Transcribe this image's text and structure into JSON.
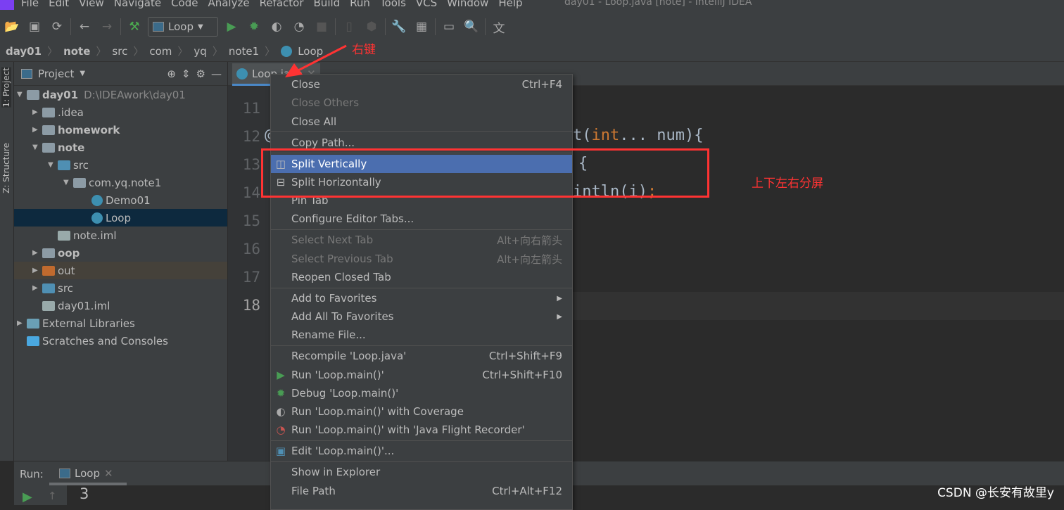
{
  "window_title": "day01 - Loop.java [note] - IntelliJ IDEA",
  "menu": [
    "File",
    "Edit",
    "View",
    "Navigate",
    "Code",
    "Analyze",
    "Refactor",
    "Build",
    "Run",
    "Tools",
    "VCS",
    "Window",
    "Help"
  ],
  "toolbar": {
    "run_config": "Loop"
  },
  "breadcrumb": [
    "day01",
    "note",
    "src",
    "com",
    "yq",
    "note1",
    "Loop"
  ],
  "sidebar": {
    "project_tab": "1: Project",
    "structure_tab": "Z: Structure"
  },
  "project": {
    "title": "Project",
    "tree": [
      {
        "label": "day01",
        "path": "D:\\IDEAwork\\day01",
        "bold": true,
        "level": 0,
        "expanded": true,
        "icon": "module-folder"
      },
      {
        "label": ".idea",
        "level": 1,
        "expanded": false,
        "icon": "folder"
      },
      {
        "label": "homework",
        "bold": true,
        "level": 1,
        "expanded": false,
        "icon": "module-folder"
      },
      {
        "label": "note",
        "bold": true,
        "level": 1,
        "expanded": true,
        "icon": "module-folder"
      },
      {
        "label": "src",
        "level": 2,
        "expanded": true,
        "icon": "source-folder"
      },
      {
        "label": "com.yq.note1",
        "level": 3,
        "expanded": true,
        "icon": "package"
      },
      {
        "label": "Demo01",
        "level": 4,
        "icon": "java-class"
      },
      {
        "label": "Loop",
        "level": 4,
        "icon": "java-class",
        "selected": true
      },
      {
        "label": "note.iml",
        "level": 2,
        "icon": "iml-file"
      },
      {
        "label": "oop",
        "bold": true,
        "level": 1,
        "expanded": false,
        "icon": "module-folder"
      },
      {
        "label": "out",
        "level": 1,
        "expanded": false,
        "icon": "excluded-folder",
        "highlight": true
      },
      {
        "label": "src",
        "level": 1,
        "expanded": false,
        "icon": "source-folder"
      },
      {
        "label": "day01.iml",
        "level": 1,
        "icon": "iml-file"
      },
      {
        "label": "External Libraries",
        "level": 0,
        "expanded": false,
        "icon": "libraries"
      },
      {
        "label": "Scratches and Consoles",
        "level": 0,
        "icon": "scratches"
      }
    ]
  },
  "editor": {
    "tab": "Loop.java",
    "line_numbers": [
      "11",
      "12",
      "13",
      "14",
      "15",
      "16",
      "17",
      "18"
    ],
    "code_fragments": {
      "l12_at": "@",
      "l12_tail_kw": "int",
      "l12_pre": "t(",
      "l12_tail": "... num){",
      "l13": "{",
      "l14": "intln(i)",
      "l14_semi": ";"
    }
  },
  "context_menu": [
    {
      "label": "Close",
      "shortcut": "Ctrl+F4"
    },
    {
      "label": "Close Others",
      "disabled": true
    },
    {
      "label": "Close All"
    },
    {
      "sep": true
    },
    {
      "label": "Copy Path..."
    },
    {
      "sep": true
    },
    {
      "label": "Split Vertically",
      "icon": "split-vertical-icon",
      "selected": true
    },
    {
      "label": "Split Horizontally",
      "icon": "split-horizontal-icon"
    },
    {
      "label": "Pin Tab"
    },
    {
      "label": "Configure Editor Tabs..."
    },
    {
      "sep": true
    },
    {
      "label": "Select Next Tab",
      "shortcut": "Alt+向右箭头",
      "disabled": true
    },
    {
      "label": "Select Previous Tab",
      "shortcut": "Alt+向左箭头",
      "disabled": true
    },
    {
      "label": "Reopen Closed Tab"
    },
    {
      "sep": true
    },
    {
      "label": "Add to Favorites",
      "submenu": true
    },
    {
      "label": "Add All To Favorites",
      "submenu": true
    },
    {
      "label": "Rename File..."
    },
    {
      "sep": true
    },
    {
      "label": "Recompile 'Loop.java'",
      "shortcut": "Ctrl+Shift+F9"
    },
    {
      "label": "Run 'Loop.main()'",
      "shortcut": "Ctrl+Shift+F10",
      "icon": "run-icon"
    },
    {
      "label": "Debug 'Loop.main()'",
      "icon": "debug-icon"
    },
    {
      "label": "Run 'Loop.main()' with Coverage",
      "icon": "coverage-icon"
    },
    {
      "label": "Run 'Loop.main()' with 'Java Flight Recorder'",
      "icon": "profiler-icon"
    },
    {
      "sep": true
    },
    {
      "label": "Edit 'Loop.main()'...",
      "icon": "edit-config-icon"
    },
    {
      "sep": true
    },
    {
      "label": "Show in Explorer"
    },
    {
      "label": "File Path",
      "shortcut": "Ctrl+Alt+F12"
    }
  ],
  "annotations": {
    "right_click": "右键",
    "split": "上下左右分屏"
  },
  "run_panel": {
    "label": "Run:",
    "tab": "Loop",
    "output": "3"
  },
  "watermark": "CSDN @长安有故里y",
  "colors": {
    "selection": "#4b6eaf",
    "annotation": "#ff3333",
    "keyword": "#cc7832"
  }
}
